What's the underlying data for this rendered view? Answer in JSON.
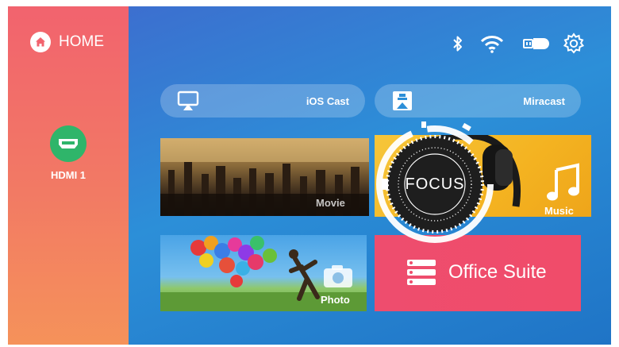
{
  "sidebar": {
    "home_label": "HOME",
    "input_label": "HDMI 1"
  },
  "status_bar": {
    "icons": [
      "bluetooth-icon",
      "wifi-icon",
      "usb-icon",
      "settings-icon"
    ]
  },
  "cast": {
    "ios_label": "iOS Cast",
    "miracast_label": "Miracast"
  },
  "tiles": {
    "movie_label": "Movie",
    "music_label": "Music",
    "photo_label": "Photo",
    "office_label": "Office Suite"
  },
  "overlay": {
    "focus_label": "FOCUS"
  },
  "colors": {
    "sidebar": "#f2636e",
    "hdmi_badge": "#2fb56a",
    "main_bg": "#2c8fd8",
    "music_tile": "#f4b321",
    "office_tile": "#ef4d6c"
  }
}
